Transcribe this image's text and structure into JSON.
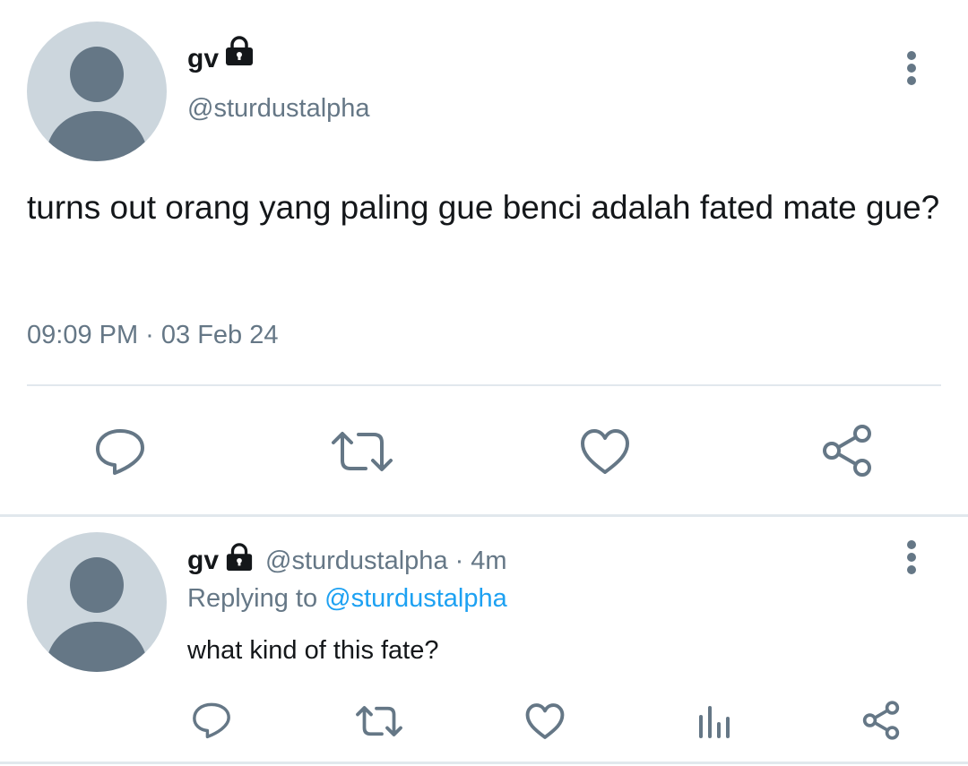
{
  "main_tweet": {
    "name": "gv",
    "handle": "@sturdustalpha",
    "text": "turns out orang yang paling gue benci adalah fated mate gue?",
    "timestamp": "09:09 PM · 03 Feb 24"
  },
  "reply_tweet": {
    "name": "gv",
    "handle": "@sturdustalpha",
    "separator": "·",
    "age": "4m",
    "replying_label": "Replying to",
    "replying_handle": "@sturdustalpha",
    "text": "what kind of this fate?"
  },
  "icons": {
    "lock": "lock-icon",
    "more": "more-vertical-icon",
    "reply": "reply-icon",
    "retweet": "retweet-icon",
    "like": "heart-icon",
    "analytics": "analytics-icon",
    "share": "share-icon"
  },
  "colors": {
    "text": "#14171a",
    "secondary": "#657786",
    "link": "#1da1f2",
    "avatar_bg": "#ccd6dd",
    "avatar_fg": "#657786",
    "divider": "#e1e8ed"
  }
}
